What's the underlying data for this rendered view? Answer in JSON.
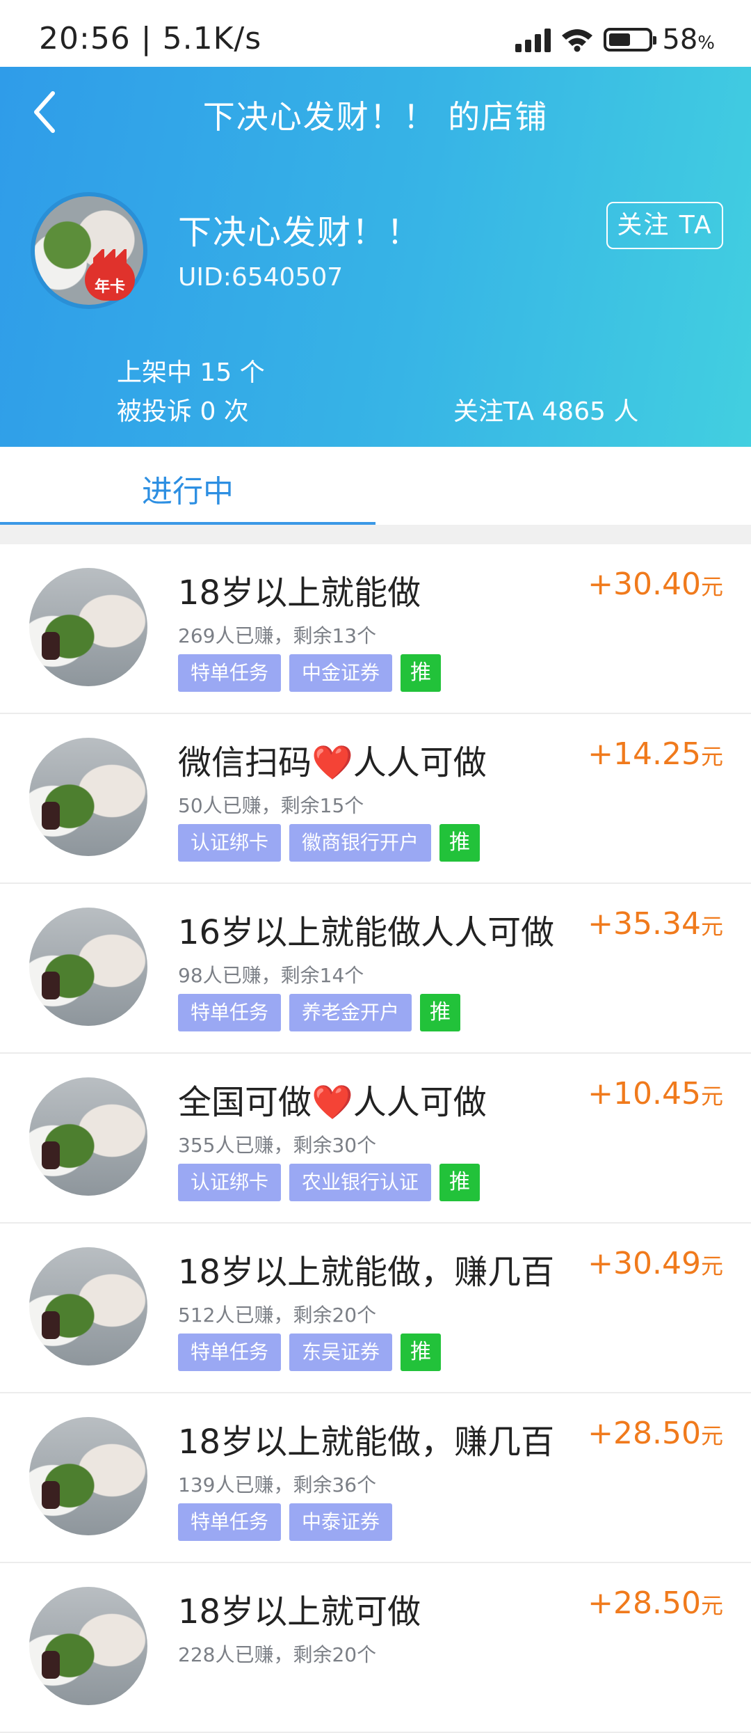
{
  "status_bar": {
    "time": "20:56 | 5.1K/s",
    "battery": "58",
    "battery_unit": "%"
  },
  "header": {
    "title": "下决心发财！！ 的店铺"
  },
  "profile": {
    "name": "下决心发财！！",
    "uid": "UID:6540507",
    "badge": "年卡",
    "follow_label": "关注 TA",
    "listed": "上架中 15 个",
    "complaints": "被投诉 0 次",
    "followers": "关注TA 4865 人"
  },
  "tabs": [
    {
      "label": "进行中",
      "active": true
    }
  ],
  "colors": {
    "accent": "#2d8fe2",
    "price": "#f07a1c",
    "tag": "#9aa8f3",
    "push": "#22c23a"
  },
  "tasks": [
    {
      "title": "18岁以上就能做",
      "sub": "269人已赚，剩余13个",
      "tags": [
        "特单任务",
        "中金证券"
      ],
      "push": "推",
      "price": "+30.40",
      "unit": "元"
    },
    {
      "title": "微信扫码❤️人人可做",
      "sub": "50人已赚，剩余15个",
      "tags": [
        "认证绑卡",
        "徽商银行开户"
      ],
      "push": "推",
      "price": "+14.25",
      "unit": "元"
    },
    {
      "title": "16岁以上就能做人人可做",
      "sub": "98人已赚，剩余14个",
      "tags": [
        "特单任务",
        "养老金开户"
      ],
      "push": "推",
      "price": "+35.34",
      "unit": "元"
    },
    {
      "title": "全国可做❤️人人可做",
      "sub": "355人已赚，剩余30个",
      "tags": [
        "认证绑卡",
        "农业银行认证"
      ],
      "push": "推",
      "price": "+10.45",
      "unit": "元"
    },
    {
      "title": "18岁以上就能做，赚几百",
      "sub": "512人已赚，剩余20个",
      "tags": [
        "特单任务",
        "东吴证券"
      ],
      "push": "推",
      "price": "+30.49",
      "unit": "元"
    },
    {
      "title": "18岁以上就能做，赚几百",
      "sub": "139人已赚，剩余36个",
      "tags": [
        "特单任务",
        "中泰证券"
      ],
      "push": "",
      "price": "+28.50",
      "unit": "元"
    },
    {
      "title": "18岁以上就可做",
      "sub": "228人已赚，剩余20个",
      "tags": [],
      "push": "",
      "price": "+28.50",
      "unit": "元"
    }
  ]
}
